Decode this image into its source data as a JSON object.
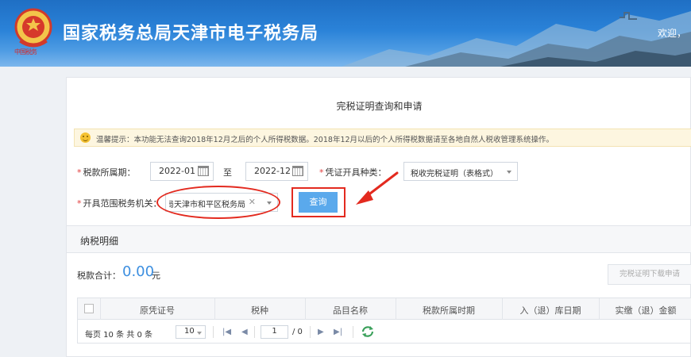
{
  "header": {
    "emblem_caption": "中国税务",
    "title": "国家税务总局天津市电子税务局",
    "welcome": "欢迎，"
  },
  "page": {
    "title": "完税证明查询和申请",
    "notice": "温馨提示：本功能无法查询2018年12月之后的个人所得税数据。2018年12月以后的个人所得税数据请至各地自然人税收管理系统操作。"
  },
  "form": {
    "period_label": "税款所属期：",
    "period_start": "2022-01",
    "period_to": "至",
    "period_end": "2022-12",
    "cert_type_label": "凭证开具种类：",
    "cert_type_value": "税收完税证明（表格式）",
    "authority_label": "开具范围税务机关：",
    "authority_value": "国家税务总局天津市和平区税务局",
    "query_button": "查询"
  },
  "details": {
    "section_title": "纳税明细",
    "total_label": "税款合计：",
    "total_amount": "0.00",
    "total_unit": "元",
    "download_button": "完税证明下载申请",
    "columns": [
      "原凭证号",
      "税种",
      "品目名称",
      "税款所属时期",
      "入（退）库日期",
      "实缴（退）金额"
    ]
  },
  "pager": {
    "per_page_prefix": "每页 10 条 共 0 条",
    "page_size": "10",
    "current_page": "1",
    "total_pages": "/ 0"
  },
  "colors": {
    "header_blue": "#2a82d8",
    "query_button": "#5aa9ec",
    "annotation_red": "#e32a1f",
    "amount_blue": "#3d8fe0"
  },
  "icons": [
    "calendar-icon",
    "smile-icon",
    "chevron-down-icon",
    "clear-icon",
    "first-page-icon",
    "prev-page-icon",
    "next-page-icon",
    "last-page-icon",
    "refresh-icon"
  ]
}
